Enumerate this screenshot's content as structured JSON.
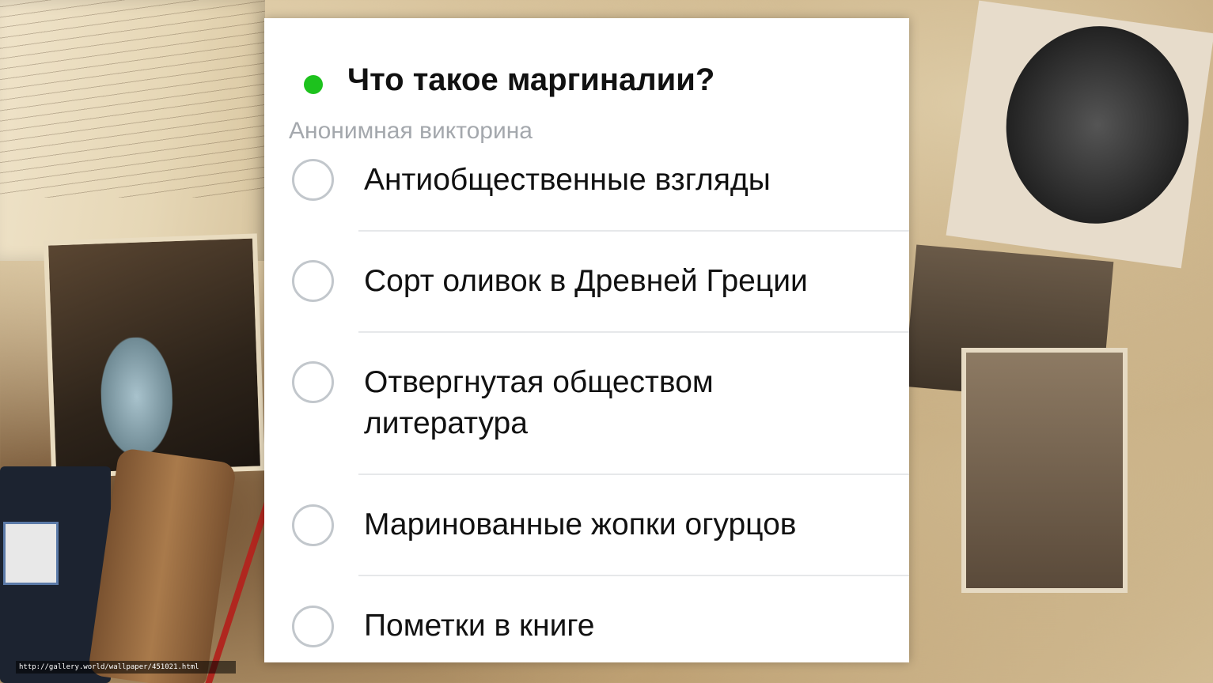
{
  "poll": {
    "question": "Что такое маргиналии?",
    "type_label": "Анонимная викторина",
    "status_color": "#1dc21d",
    "options": [
      {
        "label": "Антиобщественные взгляды"
      },
      {
        "label": "Сорт оливок в Древней Греции"
      },
      {
        "label": "Отвергнутая обществом литература"
      },
      {
        "label": "Маринованные жопки огурцов"
      },
      {
        "label": "Пометки в книге"
      }
    ]
  },
  "background": {
    "watermark": "http://gallery.world/wallpaper/451021.html"
  }
}
